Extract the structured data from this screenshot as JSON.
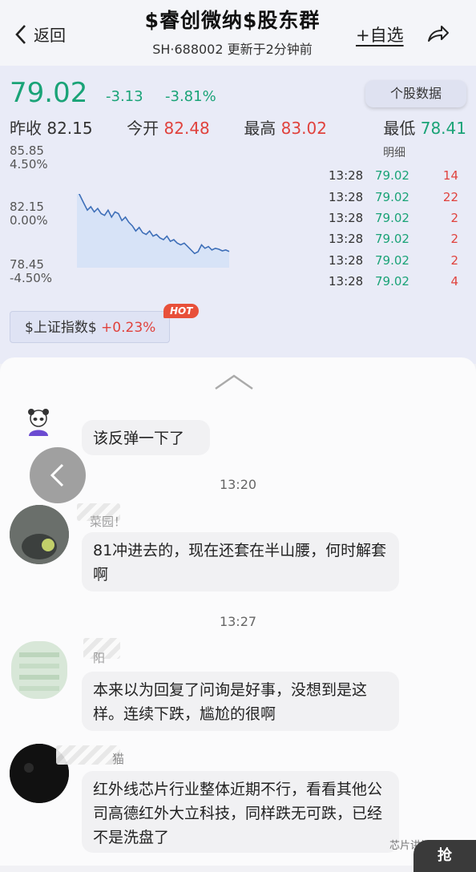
{
  "header": {
    "back_label": "返回",
    "title": "$睿创微纳$股东群",
    "subtitle": "SH·688002  更新于2分钟前",
    "watch_label": "+自选"
  },
  "quote": {
    "price": "79.02",
    "change": "-3.13",
    "change_pct": "-3.81%",
    "stock_data_label": "个股数据",
    "stats": [
      {
        "label": "昨收",
        "value": "82.15",
        "color": "dark"
      },
      {
        "label": "今开",
        "value": "82.48",
        "color": "red"
      },
      {
        "label": "最高",
        "value": "83.02",
        "color": "red"
      },
      {
        "label": "最低",
        "value": "78.41",
        "color": "green"
      }
    ],
    "axis": {
      "top_price": "85.85",
      "top_pct": "4.50%",
      "mid_price": "82.15",
      "mid_pct": "0.00%",
      "low_price": "78.45",
      "low_pct": "-4.50%"
    },
    "detail_header": "明细",
    "trades": [
      {
        "time": "13:28",
        "price": "79.02",
        "qty": "14"
      },
      {
        "time": "13:28",
        "price": "79.02",
        "qty": "22"
      },
      {
        "time": "13:28",
        "price": "79.02",
        "qty": "2"
      },
      {
        "time": "13:28",
        "price": "79.02",
        "qty": "2"
      },
      {
        "time": "13:28",
        "price": "79.02",
        "qty": "2"
      },
      {
        "time": "13:28",
        "price": "79.02",
        "qty": "4"
      }
    ],
    "index_chip_label": "$上证指数$",
    "index_chip_change": "+0.23%",
    "hot_label": "HOT",
    "intraday": [
      82.6,
      82.2,
      81.8,
      81.4,
      81.6,
      81.3,
      81.5,
      81.2,
      81.1,
      81.4,
      81.0,
      81.3,
      81.2,
      80.8,
      81.0,
      80.7,
      80.5,
      80.2,
      80.4,
      80.1,
      80.0,
      80.2,
      79.9,
      80.0,
      79.8,
      79.7,
      79.9,
      79.6,
      79.7,
      79.5,
      79.4,
      79.5,
      79.3,
      79.1,
      78.9,
      79.0,
      79.4,
      79.2,
      79.3,
      79.1,
      79.2,
      79.15,
      79.05,
      79.1,
      79.02
    ]
  },
  "chat": {
    "messages": [
      {
        "text": "该反弹一下了"
      },
      {
        "time": "13:20"
      },
      {
        "nick": "菜园！",
        "text": "81冲进去的，现在还套在半山腰，何时解套啊"
      },
      {
        "time": "13:27"
      },
      {
        "nick": "阳",
        "text": "本来以为回复了问询是好事，没想到是这样。连续下跌，尴尬的很啊"
      },
      {
        "nick": "猫",
        "text": "红外线芯片行业整体近期不行，看看其他公司高德红外大立科技，同样跌无可跌，已经不是洗盘了"
      }
    ],
    "watermark": "芯片讲坛",
    "corner_label": "抢"
  }
}
